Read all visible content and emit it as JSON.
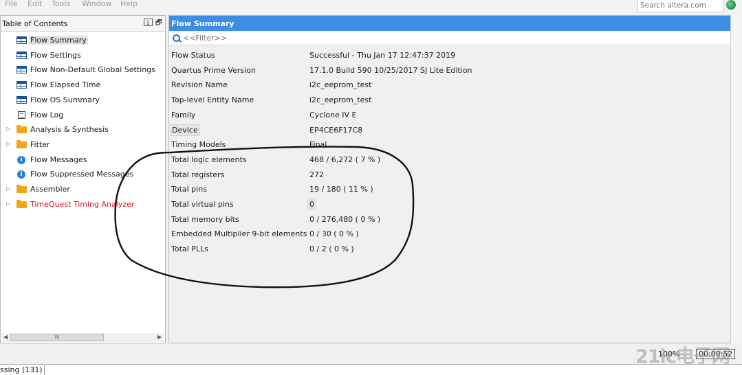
{
  "menu": {
    "items": [
      "File",
      "Edit",
      "Tools",
      "Window",
      "Help"
    ],
    "search_placeholder": "Search altera.com"
  },
  "toc": {
    "title": "Table of Contents",
    "items": [
      {
        "label": "Flow Summary",
        "icon": "table-icon",
        "expandable": false,
        "selected": true,
        "red": false
      },
      {
        "label": "Flow Settings",
        "icon": "table-icon",
        "expandable": false,
        "selected": false,
        "red": false
      },
      {
        "label": "Flow Non-Default Global Settings",
        "icon": "table-icon",
        "expandable": false,
        "selected": false,
        "red": false
      },
      {
        "label": "Flow Elapsed Time",
        "icon": "table-icon",
        "expandable": false,
        "selected": false,
        "red": false
      },
      {
        "label": "Flow OS Summary",
        "icon": "table-icon",
        "expandable": false,
        "selected": false,
        "red": false
      },
      {
        "label": "Flow Log",
        "icon": "log-icon",
        "expandable": false,
        "selected": false,
        "red": false
      },
      {
        "label": "Analysis & Synthesis",
        "icon": "folder-icon",
        "expandable": true,
        "selected": false,
        "red": false
      },
      {
        "label": "Fitter",
        "icon": "folder-icon",
        "expandable": true,
        "selected": false,
        "red": false
      },
      {
        "label": "Flow Messages",
        "icon": "info-icon",
        "expandable": false,
        "selected": false,
        "red": false
      },
      {
        "label": "Flow Suppressed Messages",
        "icon": "info-icon",
        "expandable": false,
        "selected": false,
        "red": false
      },
      {
        "label": "Assembler",
        "icon": "folder-icon",
        "expandable": true,
        "selected": false,
        "red": false
      },
      {
        "label": "TimeQuest Timing Analyzer",
        "icon": "folder-icon",
        "expandable": true,
        "selected": false,
        "red": true
      }
    ],
    "scroll_grip": "III"
  },
  "summary": {
    "title": "Flow Summary",
    "filter_placeholder": "<<Filter>>",
    "rows": [
      {
        "key": "Flow Status",
        "value": "Successful - Thu Jan 17 12:47:37 2019"
      },
      {
        "key": "Quartus Prime Version",
        "value": "17.1.0 Build 590 10/25/2017 SJ Lite Edition"
      },
      {
        "key": "Revision Name",
        "value": "i2c_eeprom_test"
      },
      {
        "key": "Top-level Entity Name",
        "value": "i2c_eeprom_test"
      },
      {
        "key": "Family",
        "value": "Cyclone IV E"
      },
      {
        "key": "Device",
        "value": "EP4CE6F17C8"
      },
      {
        "key": "Timing Models",
        "value": "Final"
      },
      {
        "key": "Total logic elements",
        "value": "468 / 6,272 ( 7 % )"
      },
      {
        "key": "Total registers",
        "value": "272"
      },
      {
        "key": "Total pins",
        "value": "19 / 180 ( 11 % )"
      },
      {
        "key": "Total virtual pins",
        "value": "0"
      },
      {
        "key": "Total memory bits",
        "value": "0 / 276,480 ( 0 % )"
      },
      {
        "key": "Embedded Multiplier 9-bit elements",
        "value": "0 / 30 ( 0 % )"
      },
      {
        "key": "Total PLLs",
        "value": "0 / 2 ( 0 % )"
      }
    ]
  },
  "status": {
    "zoom": "100%",
    "elapsed": "00:00:52"
  },
  "watermark": "21ic电子网",
  "bottom_tab": "ssing (131)",
  "colors": {
    "header_blue": "#3e8ee6",
    "annotation": "#111111",
    "red_item": "#d8141e"
  }
}
